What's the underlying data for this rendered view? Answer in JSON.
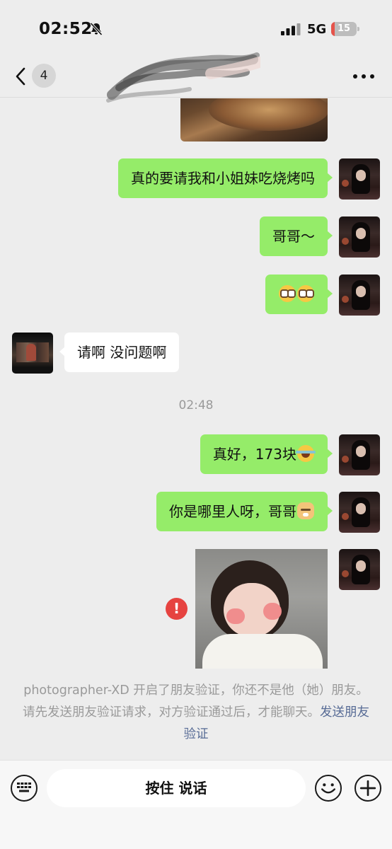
{
  "status_bar": {
    "time": "02:52",
    "network": "5G",
    "battery_level": "15",
    "battery_color": "#e5534b"
  },
  "nav": {
    "back_icon": "chevron-left-icon",
    "unread_count": "4",
    "more_icon": "more-horizontal-icon"
  },
  "messages": [
    {
      "dir": "out",
      "text": "真的要请我和小姐妹吃烧烤吗"
    },
    {
      "dir": "out",
      "text": "哥哥～"
    },
    {
      "dir": "out",
      "emoji": [
        "pleading-face",
        "pleading-face"
      ]
    },
    {
      "dir": "in",
      "text": "请啊 没问题啊"
    },
    {
      "dir": "out",
      "text": "真好，173块",
      "emoji": [
        "laughing-tears-face"
      ]
    },
    {
      "dir": "out",
      "text": "你是哪里人呀，哥哥",
      "emoji": [
        "doge-face"
      ]
    }
  ],
  "timestamp": "02:48",
  "failed_icon": "!",
  "system_notice": {
    "text": "photographer-XD 开启了朋友验证，你还不是他（她）朋友。请先发送朋友验证请求，对方验证通过后，才能聊天。",
    "link": "发送朋友验证"
  },
  "input_bar": {
    "hold_to_talk": "按住 说话",
    "keyboard_icon": "keyboard-icon",
    "emoji_icon": "smiley-icon",
    "plus_icon": "plus-icon"
  },
  "colors": {
    "outgoing_bubble": "#95ec69",
    "incoming_bubble": "#ffffff",
    "background": "#ededed",
    "link": "#576b95",
    "error": "#e64340"
  }
}
